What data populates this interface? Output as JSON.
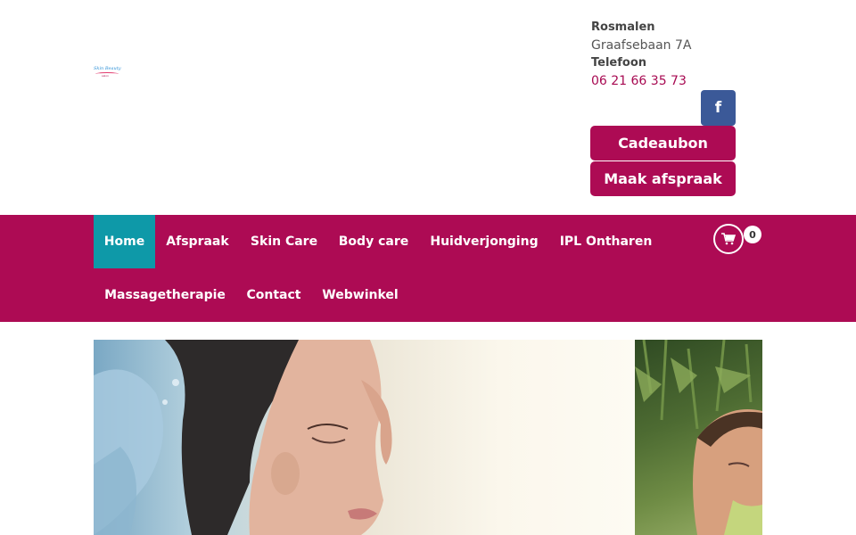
{
  "logo": {
    "line1": "Skin Beauty",
    "line2": "salon",
    "icon": "salon-logo"
  },
  "contact": {
    "city": "Rosmalen",
    "address": "Graafsebaan 7A",
    "phone_label": "Telefoon",
    "phone": "06 21 66 35 73"
  },
  "social": {
    "facebook_icon": "facebook-icon",
    "facebook_glyph": "f",
    "facebook_color": "#3b5998"
  },
  "actions": {
    "gift_label": "Cadeaubon",
    "appointment_label": "Maak afspraak"
  },
  "nav": {
    "items": [
      {
        "label": "Home",
        "active": true
      },
      {
        "label": "Afspraak"
      },
      {
        "label": "Skin Care"
      },
      {
        "label": "Body care"
      },
      {
        "label": "Huidverjonging"
      },
      {
        "label": "IPL Ontharen"
      },
      {
        "label": "Massagetherapie"
      },
      {
        "label": "Contact"
      },
      {
        "label": "Webwinkel"
      }
    ],
    "cart_icon": "cart-icon",
    "cart_count": "0"
  },
  "colors": {
    "brand": "#ad0b54",
    "active_nav": "#0e99a8",
    "facebook": "#3b5998"
  }
}
